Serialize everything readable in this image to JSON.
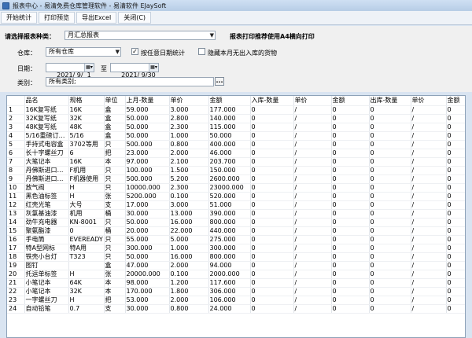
{
  "window": {
    "title": "报表中心 - 易清免费仓库管理软件 - 易清软件 EJaySoft"
  },
  "menu": [
    "开始统计",
    "打印预览",
    "导出Excel",
    "关闭(C)"
  ],
  "form": {
    "report_type_label": "请选择报表种类：",
    "report_type_value": "月汇总报表",
    "print_note": "报表打印推荐使用A4横向打印",
    "warehouse_label": "仓库：",
    "warehouse_value": "所有仓库",
    "any_date_label": "按任意日期统计",
    "any_date_checked": "✓",
    "hide_label": "隐藏本月无出入库的货物",
    "date_label": "日期：",
    "date_from": "2021/ 9/  1",
    "date_to_sep": "至",
    "date_to": "2021/ 9/30",
    "category_label": "类别：",
    "category_value": "所有类别;",
    "ellipsis": "..."
  },
  "table": {
    "headers": [
      "",
      "品名",
      "规格",
      "单位",
      "上月-数量",
      "单价",
      "金额",
      "入库-数量",
      "单价",
      "金额",
      "出库-数量",
      "单价",
      "金额"
    ],
    "rows": [
      [
        "1",
        "16K复写纸",
        "16K",
        "盒",
        "59.000",
        "3.000",
        "177.000",
        "0",
        "/",
        "0",
        "0",
        "/",
        "0"
      ],
      [
        "2",
        "32K复写纸",
        "32K",
        "盒",
        "50.000",
        "2.800",
        "140.000",
        "0",
        "/",
        "0",
        "0",
        "/",
        "0"
      ],
      [
        "3",
        "48K复写纸",
        "48K",
        "盒",
        "50.000",
        "2.300",
        "115.000",
        "0",
        "/",
        "0",
        "0",
        "/",
        "0"
      ],
      [
        "4",
        "5/16重磅订…",
        "5/16",
        "盒",
        "50.000",
        "1.000",
        "50.000",
        "0",
        "/",
        "0",
        "0",
        "/",
        "0"
      ],
      [
        "5",
        "手持式电容盒",
        "3702等用",
        "只",
        "500.000",
        "0.800",
        "400.000",
        "0",
        "/",
        "0",
        "0",
        "/",
        "0"
      ],
      [
        "6",
        "长十字螺丝刀",
        "6",
        "把",
        "23.000",
        "2.000",
        "46.000",
        "0",
        "/",
        "0",
        "0",
        "/",
        "0"
      ],
      [
        "7",
        "大笔记本",
        "16K",
        "本",
        "97.000",
        "2.100",
        "203.700",
        "0",
        "/",
        "0",
        "0",
        "/",
        "0"
      ],
      [
        "8",
        "丹佛斯进口…",
        "F机用",
        "只",
        "100.000",
        "1.500",
        "150.000",
        "0",
        "/",
        "0",
        "0",
        "/",
        "0"
      ],
      [
        "9",
        "丹佛斯进口…",
        "F机器使用",
        "只",
        "500.000",
        "5.200",
        "2600.000",
        "0",
        "/",
        "0",
        "0",
        "/",
        "0"
      ],
      [
        "10",
        "放气阀",
        "H",
        "只",
        "10000.000",
        "2.300",
        "23000.000",
        "0",
        "/",
        "0",
        "0",
        "/",
        "0"
      ],
      [
        "11",
        "黑色油标签",
        "H",
        "张",
        "5200.000",
        "0.100",
        "520.000",
        "0",
        "/",
        "0",
        "0",
        "/",
        "0"
      ],
      [
        "12",
        "红壳光笔",
        "大号",
        "支",
        "17.000",
        "3.000",
        "51.000",
        "0",
        "/",
        "0",
        "0",
        "/",
        "0"
      ],
      [
        "13",
        "灰氯基油漆",
        "机用",
        "桶",
        "30.000",
        "13.000",
        "390.000",
        "0",
        "/",
        "0",
        "0",
        "/",
        "0"
      ],
      [
        "14",
        "劲牛充电器",
        "KN-8001",
        "只",
        "50.000",
        "16.000",
        "800.000",
        "0",
        "/",
        "0",
        "0",
        "/",
        "0"
      ],
      [
        "15",
        "聚氨酯漆",
        "0",
        "桶",
        "20.000",
        "22.000",
        "440.000",
        "0",
        "/",
        "0",
        "0",
        "/",
        "0"
      ],
      [
        "16",
        "手电筒",
        "EVEREADY",
        "只",
        "55.000",
        "5.000",
        "275.000",
        "0",
        "/",
        "0",
        "0",
        "/",
        "0"
      ],
      [
        "17",
        "特A型网标",
        "特A用",
        "只",
        "300.000",
        "1.000",
        "300.000",
        "0",
        "/",
        "0",
        "0",
        "/",
        "0"
      ],
      [
        "18",
        "铁壳小台灯",
        "T323",
        "只",
        "50.000",
        "16.000",
        "800.000",
        "0",
        "/",
        "0",
        "0",
        "/",
        "0"
      ],
      [
        "19",
        "图钉",
        "",
        "盒",
        "47.000",
        "2.000",
        "94.000",
        "0",
        "/",
        "0",
        "0",
        "/",
        "0"
      ],
      [
        "20",
        "托运单标签",
        "H",
        "张",
        "20000.000",
        "0.100",
        "2000.000",
        "0",
        "/",
        "0",
        "0",
        "/",
        "0"
      ],
      [
        "21",
        "小笔记本",
        "64K",
        "本",
        "98.000",
        "1.200",
        "117.600",
        "0",
        "/",
        "0",
        "0",
        "/",
        "0"
      ],
      [
        "22",
        "小笔记本",
        "32K",
        "本",
        "170.000",
        "1.800",
        "306.000",
        "0",
        "/",
        "0",
        "0",
        "/",
        "0"
      ],
      [
        "23",
        "一字螺丝刀",
        "H",
        "把",
        "53.000",
        "2.000",
        "106.000",
        "0",
        "/",
        "0",
        "0",
        "/",
        "0"
      ],
      [
        "24",
        "自动铅笔",
        "0.7",
        "支",
        "30.000",
        "0.800",
        "24.000",
        "0",
        "/",
        "0",
        "0",
        "/",
        "0"
      ]
    ]
  },
  "colors": {
    "titlebar": "#b7cde6",
    "form_bg": "#f0f0f0",
    "grid_border": "#8ea2b8"
  }
}
